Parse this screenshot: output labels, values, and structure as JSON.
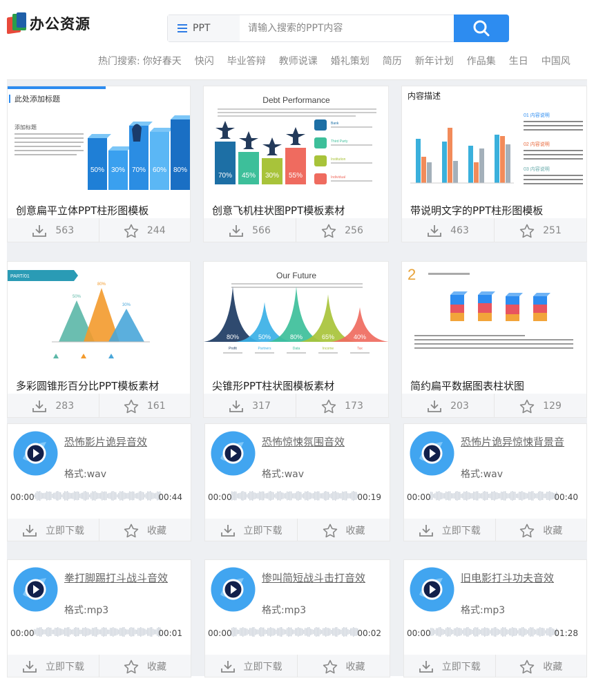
{
  "header": {
    "logo_text": "办公资源",
    "search": {
      "type_label": "PPT",
      "placeholder": "请输入搜索的PPT内容"
    },
    "hot_label": "热门搜索:",
    "hot_terms": [
      "你好春天",
      "快闪",
      "毕业答辩",
      "教师说课",
      "婚礼策划",
      "简历",
      "新年计划",
      "作品集",
      "生日",
      "中国风"
    ]
  },
  "ppt_cards": [
    {
      "title": "创意扁平立体PPT柱形图模板",
      "downloads": "563",
      "favorites": "244",
      "thumb": {
        "heading": "此处添加标题",
        "sub_heading": "添加标题",
        "bar_labels": [
          "50%",
          "30%",
          "70%",
          "60%",
          "80%"
        ],
        "bar_values": [
          50,
          30,
          70,
          60,
          80
        ]
      }
    },
    {
      "title": "创意飞机柱状图PPT模板素材",
      "downloads": "566",
      "favorites": "256",
      "thumb": {
        "heading": "Debt Performance",
        "bar_labels": [
          "70%",
          "45%",
          "30%",
          "55%"
        ],
        "bar_values": [
          70,
          45,
          30,
          55
        ],
        "legend": [
          "Bank",
          "Third Party",
          "Institution",
          "Individual"
        ]
      }
    },
    {
      "title": "带说明文字的PPT柱形图模板",
      "downloads": "463",
      "favorites": "251",
      "thumb": {
        "heading": "内容描述",
        "notes": [
          "01 内容说明",
          "02 内容说明",
          "03 内容说明"
        ]
      }
    },
    {
      "title": "多彩圆锥形百分比PPT模板素材",
      "downloads": "283",
      "favorites": "161",
      "thumb": {
        "tag": "PART/01",
        "cone_labels": [
          "50%",
          "80%",
          "30%"
        ],
        "cone_values": [
          50,
          80,
          30
        ]
      }
    },
    {
      "title": "尖锥形PPT柱状图模板素材",
      "downloads": "317",
      "favorites": "173",
      "thumb": {
        "heading": "Our Future",
        "peak_labels": [
          "80%",
          "50%",
          "80%",
          "65%",
          "40%"
        ],
        "peak_values": [
          80,
          50,
          80,
          65,
          40
        ],
        "captions": [
          "Profit",
          "Partners",
          "Data",
          "Income",
          "Tax"
        ]
      }
    },
    {
      "title": "简约扁平数据图表柱状图",
      "downloads": "203",
      "favorites": "129",
      "thumb": {
        "number": "2"
      }
    }
  ],
  "audio_cards": [
    {
      "title": "恐怖影片诡异音效",
      "format": "格式:wav",
      "start": "00:00",
      "end": "00:44"
    },
    {
      "title": "恐怖惊悚氛围音效",
      "format": "格式:wav",
      "start": "00:00",
      "end": "00:19"
    },
    {
      "title": "恐怖片诡异惊悚背景音",
      "format": "格式:wav",
      "start": "00:00",
      "end": "00:40"
    },
    {
      "title": "拳打脚踢打斗战斗音效",
      "format": "格式:mp3",
      "start": "00:00",
      "end": "00:01"
    },
    {
      "title": "惨叫简短战斗击打音效",
      "format": "格式:mp3",
      "start": "00:00",
      "end": "00:02"
    },
    {
      "title": "旧电影打斗功夫音效",
      "format": "格式:mp3",
      "start": "00:00",
      "end": "01:28"
    }
  ],
  "audio_actions": {
    "download_label": "立即下载",
    "favorite_label": "收藏"
  },
  "colors": {
    "accent": "#2d8cf0",
    "disc": "#41a5f0",
    "wave": "#cfd5dd"
  }
}
